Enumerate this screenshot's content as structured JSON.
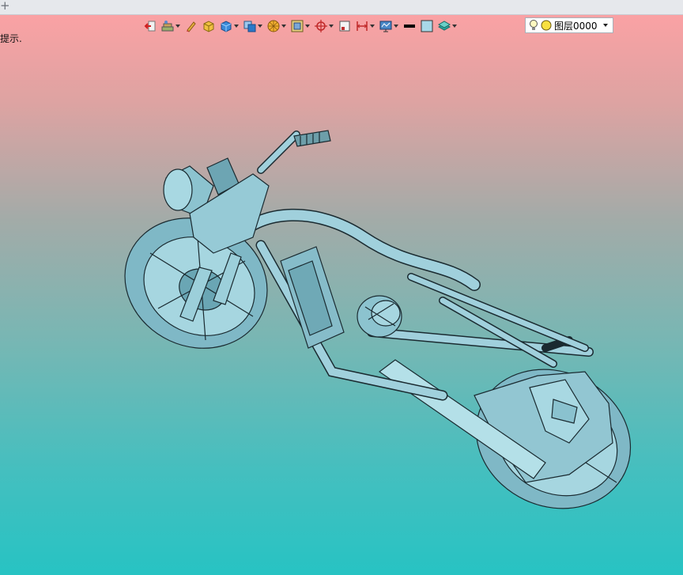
{
  "tabstrip": {
    "add_icon": "+"
  },
  "hint": {
    "text": "提示."
  },
  "toolbar": {
    "icons": [
      "exit-icon",
      "layer-manager-icon",
      "pencil-icon",
      "box-solid-icon",
      "cube-view-icon",
      "display-mode-icon",
      "render-sphere-icon",
      "frame-icon",
      "center-target-icon",
      "square-icon",
      "dimension-icon",
      "screen-view-icon",
      "line-color-swatch-icon",
      "fill-color-swatch-icon",
      "layer-stack-icon"
    ],
    "line_color": "#000000",
    "fill_color": "#a8d8e8"
  },
  "layer": {
    "name": "图层0000"
  },
  "colors": {
    "bg_top": "#ffa1a4",
    "bg_bottom": "#27c3c3",
    "model": "#8ecbd8"
  }
}
